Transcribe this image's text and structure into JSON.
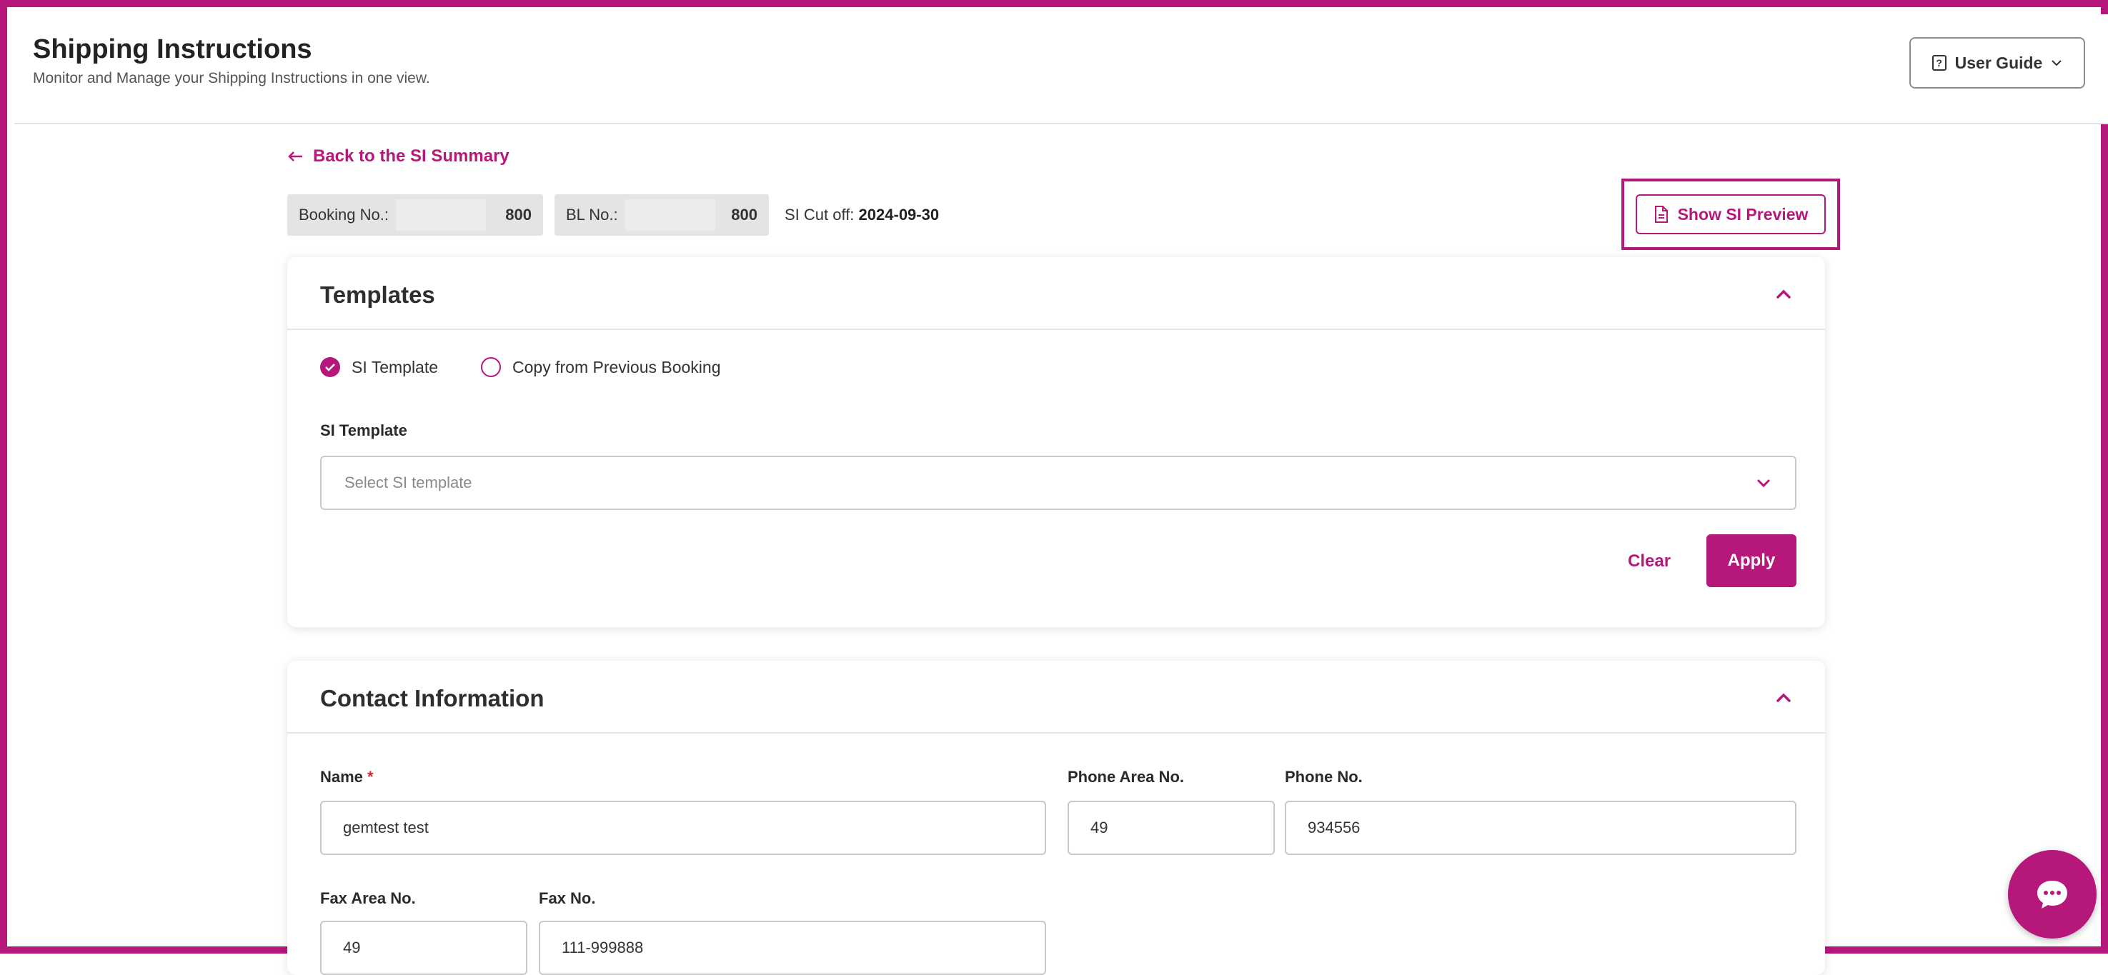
{
  "header": {
    "title": "Shipping Instructions",
    "subtitle": "Monitor and Manage your Shipping Instructions in one view.",
    "user_guide_label": "User Guide"
  },
  "nav": {
    "back_label": "Back to the SI Summary"
  },
  "references": {
    "booking_label": "Booking No.:",
    "booking_value": "800",
    "bl_label": "BL No.:",
    "bl_value": "800",
    "cutoff_label": "SI Cut off:",
    "cutoff_value": "2024-09-30"
  },
  "preview_button_label": "Show SI Preview",
  "templates": {
    "title": "Templates",
    "options": [
      "SI Template",
      "Copy from Previous Booking"
    ],
    "selected_option": "SI Template",
    "field_label": "SI Template",
    "select_placeholder": "Select SI template",
    "clear_label": "Clear",
    "apply_label": "Apply"
  },
  "contact": {
    "title": "Contact Information",
    "name_label": "Name",
    "required_mark": "*",
    "name_value": "gemtest test",
    "phone_area_label": "Phone Area No.",
    "phone_area_value": "49",
    "phone_label": "Phone No.",
    "phone_value": "934556",
    "fax_area_label": "Fax Area No.",
    "fax_area_value": "49",
    "fax_label": "Fax No.",
    "fax_value": "111-999888"
  },
  "colors": {
    "accent": "#b5177a",
    "required": "#d6262f"
  },
  "icons": [
    "question-book-icon",
    "chevron-down-icon",
    "arrow-left-icon",
    "document-icon",
    "chevron-up-icon",
    "check-circle-icon",
    "chat-bubble-icon"
  ]
}
